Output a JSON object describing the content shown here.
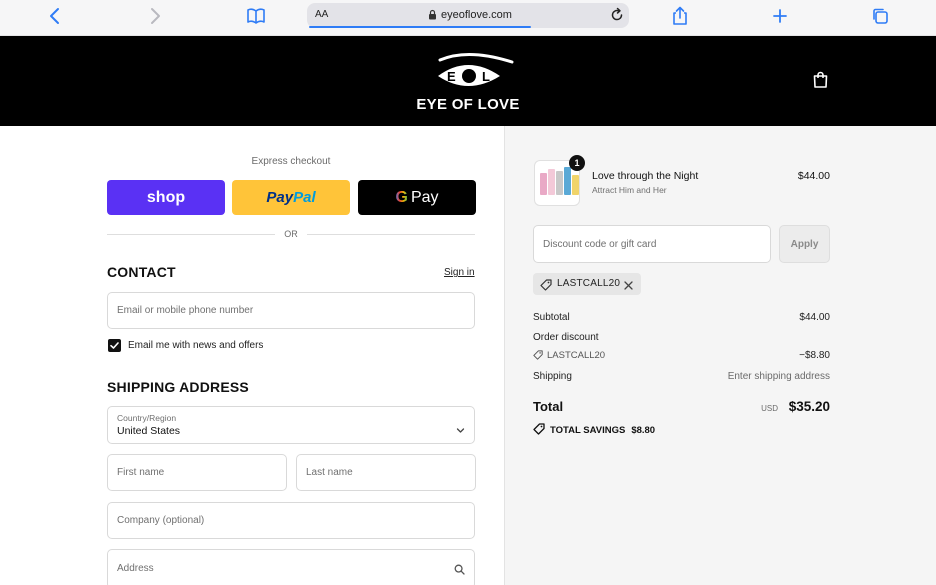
{
  "browser": {
    "text_size_label": "AA",
    "url": "eyeoflove.com",
    "load_progress": 0.69
  },
  "header": {
    "logo_letters": "E O L",
    "logo_text": "EYE OF LOVE",
    "background": "#000000"
  },
  "express": {
    "label": "Express checkout",
    "shop_label": "shop",
    "paypal_label_1": "Pay",
    "paypal_label_2": "Pal",
    "gpay_g": "G",
    "gpay_label": "Pay",
    "or_label": "OR",
    "colors": {
      "shop": "#5a31f4",
      "paypal": "#ffc439",
      "gpay": "#000000"
    }
  },
  "contact": {
    "title": "CONTACT",
    "signin": "Sign in",
    "email_placeholder": "Email or mobile phone number",
    "newsletter_label": "Email me with news and offers",
    "newsletter_checked": true
  },
  "shipping": {
    "title": "SHIPPING ADDRESS",
    "country_label": "Country/Region",
    "country_value": "United States",
    "first_name_placeholder": "First name",
    "last_name_placeholder": "Last name",
    "company_placeholder": "Company (optional)",
    "address_placeholder": "Address"
  },
  "summary": {
    "item": {
      "quantity": "1",
      "name": "Love through the Night",
      "subtitle": "Attract Him and Her",
      "price": "$44.00"
    },
    "discount_placeholder": "Discount code or gift card",
    "apply_label": "Apply",
    "applied_code": "LASTCALL20",
    "subtotal_label": "Subtotal",
    "subtotal_value": "$44.00",
    "order_discount_label": "Order discount",
    "order_discount_code": "LASTCALL20",
    "order_discount_value": "−$8.80",
    "shipping_label": "Shipping",
    "shipping_value": "Enter shipping address",
    "total_label": "Total",
    "total_currency": "USD",
    "total_value": "$35.20",
    "savings_label": "TOTAL SAVINGS",
    "savings_value": "$8.80"
  }
}
